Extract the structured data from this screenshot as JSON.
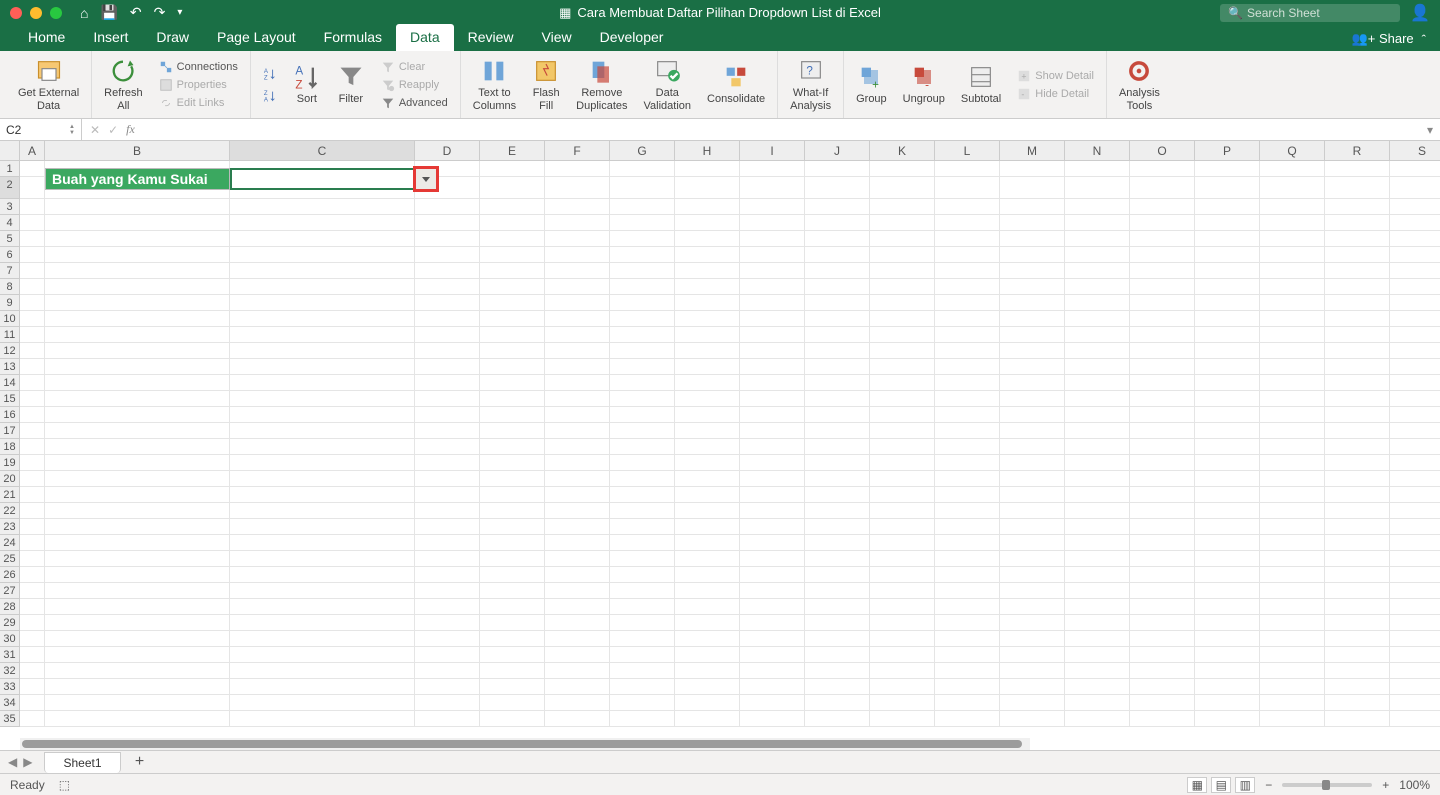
{
  "title": "Cara Membuat Daftar Pilihan Dropdown List di Excel",
  "search_placeholder": "Search Sheet",
  "menu": {
    "items": [
      "Home",
      "Insert",
      "Draw",
      "Page Layout",
      "Formulas",
      "Data",
      "Review",
      "View",
      "Developer"
    ],
    "active": "Data",
    "share": "Share"
  },
  "ribbon": {
    "get_external_data": "Get External\nData",
    "refresh_all": "Refresh\nAll",
    "connections": "Connections",
    "properties": "Properties",
    "edit_links": "Edit Links",
    "sort": "Sort",
    "filter": "Filter",
    "clear": "Clear",
    "reapply": "Reapply",
    "advanced": "Advanced",
    "text_to_columns": "Text to\nColumns",
    "flash_fill": "Flash\nFill",
    "remove_duplicates": "Remove\nDuplicates",
    "data_validation": "Data\nValidation",
    "consolidate": "Consolidate",
    "what_if": "What-If\nAnalysis",
    "group": "Group",
    "ungroup": "Ungroup",
    "subtotal": "Subtotal",
    "show_detail": "Show Detail",
    "hide_detail": "Hide Detail",
    "analysis_tools": "Analysis\nTools"
  },
  "formula_bar": {
    "name_box": "C2",
    "fx": "fx",
    "value": ""
  },
  "grid": {
    "columns": [
      "A",
      "B",
      "C",
      "D",
      "E",
      "F",
      "G",
      "H",
      "I",
      "J",
      "K",
      "L",
      "M",
      "N",
      "O",
      "P",
      "Q",
      "R",
      "S"
    ],
    "row_count": 35,
    "selected_cell": "C2",
    "label_b2": "Buah yang Kamu Sukai",
    "col_widths": {
      "A": 25,
      "B": 185,
      "C": 185,
      "default": 65
    }
  },
  "sheet_tabs": {
    "active": "Sheet1"
  },
  "status": {
    "ready": "Ready",
    "zoom": "100%"
  }
}
